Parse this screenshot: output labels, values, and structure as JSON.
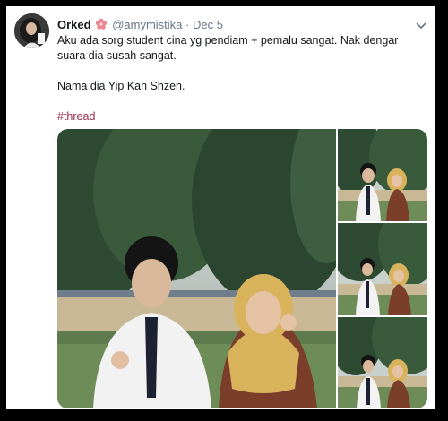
{
  "tweet": {
    "display_name": "Orked",
    "handle": "@amymistika",
    "separator": "·",
    "date": "Dec 5",
    "lines": [
      "Aku ada sorg student cina yg pendiam + pemalu sangat. Nak dengar suara dia susah sangat.",
      "Nama dia Yip Kah Shzen."
    ],
    "hashtag": "#thread",
    "media": [
      {
        "name": "main-photo",
        "icon": "photo"
      },
      {
        "name": "thumb-photo-1",
        "icon": "photo"
      },
      {
        "name": "thumb-photo-2",
        "icon": "photo"
      },
      {
        "name": "thumb-photo-3",
        "icon": "photo"
      }
    ]
  },
  "colors": {
    "text": "#14171a",
    "secondary": "#657786",
    "hashtag": "#9b2f4c",
    "flower": "#e8878f"
  },
  "icons": {
    "header_emoji": "cherry-blossom-icon",
    "menu": "chevron-down-icon"
  }
}
